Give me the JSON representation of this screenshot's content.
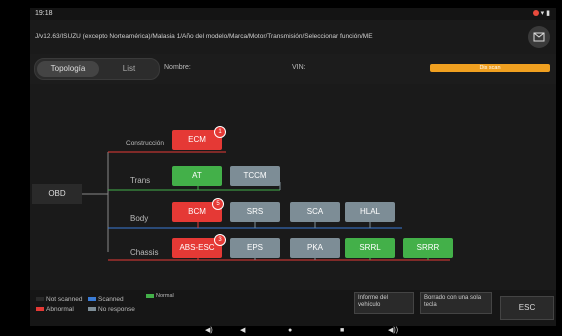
{
  "status": {
    "time": "19:18"
  },
  "header": {
    "path": "J/v12.63/ISUZU (excepto Norteamérica)/Malasia 1/Año del modelo/Marca/Motor/Transmisión/Seleccionar función/ME"
  },
  "toolbar": {
    "tab_topology": "Topología",
    "tab_list": "List",
    "name_label": "Nombre:",
    "vin_label": "VIN:",
    "disc_scan": "Dis scan"
  },
  "topology": {
    "obd": "OBD",
    "groups": {
      "construccion": "Construcción",
      "trans": "Trans",
      "body": "Body",
      "chassis": "Chassis"
    },
    "nodes": {
      "ecm": "ECM",
      "at": "AT",
      "tccm": "TCCM",
      "bcm": "BCM",
      "srs": "SRS",
      "sca": "SCA",
      "hlal": "HLAL",
      "absesc": "ABS-ESC",
      "eps": "EPS",
      "pka": "PKA",
      "srrl": "SRRL",
      "srrr": "SRRR"
    },
    "badges": {
      "ecm": "1",
      "bcm": "5",
      "absesc": "3"
    }
  },
  "legend": {
    "not_scanned": "Not scanned",
    "scanned": "Scanned",
    "normal": "Normal",
    "abnormal": "Abnormal",
    "no_response": "No response"
  },
  "buttons": {
    "report": "Informe del vehículo",
    "one_touch_clear": "Borrado con una sola tecla",
    "esc": "ESC"
  },
  "colors": {
    "abnormal": "#e53935",
    "normal": "#43b049",
    "no_response": "#7d8d96",
    "scanned": "#3a7bd5",
    "accent": "#f0a020"
  },
  "navbar": {
    "volume_down": "◀)",
    "back": "◀",
    "home": "●",
    "recent": "■",
    "volume_up": "◀))"
  }
}
